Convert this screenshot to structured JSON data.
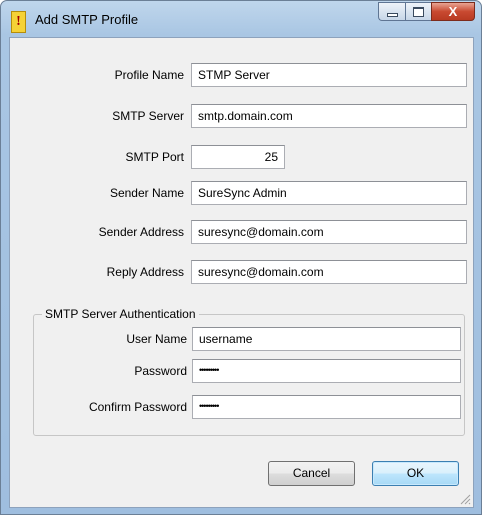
{
  "window": {
    "title": "Add SMTP Profile",
    "title_icon_glyph": "!",
    "caption": {
      "close_glyph": "X"
    }
  },
  "form": {
    "profile_name": {
      "label": "Profile Name",
      "value": "STMP Server"
    },
    "smtp_server": {
      "label": "SMTP Server",
      "value": "smtp.domain.com"
    },
    "smtp_port": {
      "label": "SMTP Port",
      "value": "25"
    },
    "sender_name": {
      "label": "Sender Name",
      "value": "SureSync Admin"
    },
    "sender_address": {
      "label": "Sender Address",
      "value": "suresync@domain.com"
    },
    "reply_address": {
      "label": "Reply Address",
      "value": "suresync@domain.com"
    }
  },
  "auth": {
    "group_label": "SMTP Server Authentication",
    "user_name": {
      "label": "User Name",
      "value": "username"
    },
    "password": {
      "label": "Password",
      "value": "•••••••••"
    },
    "confirm_password": {
      "label": "Confirm Password",
      "value": "•••••••••"
    }
  },
  "buttons": {
    "cancel": "Cancel",
    "ok": "OK"
  },
  "icons": {
    "title": "warning-exclamation-icon",
    "minimize": "minimize-icon",
    "maximize": "maximize-icon",
    "close": "close-icon",
    "resize": "resize-grip-icon"
  }
}
